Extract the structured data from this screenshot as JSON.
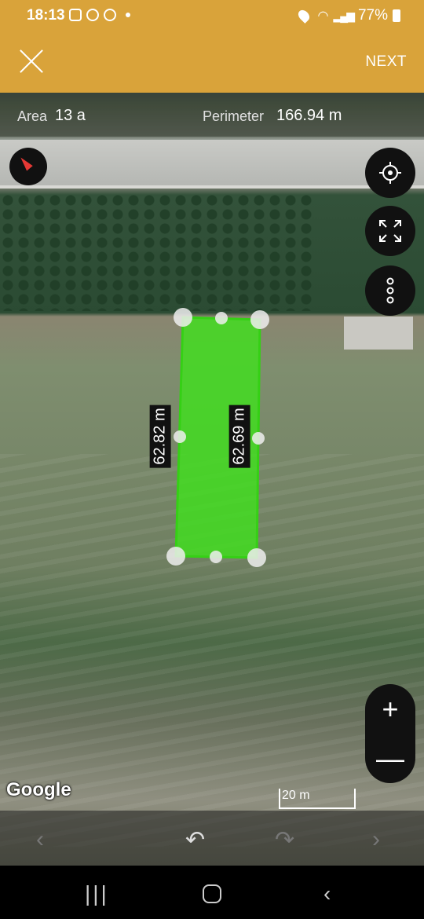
{
  "status_bar": {
    "time": "18:13",
    "battery": "77%"
  },
  "toolbar": {
    "next_label": "NEXT"
  },
  "measurements": {
    "area_label": "Area",
    "area_value": "13 a",
    "perimeter_label": "Perimeter",
    "perimeter_value": "166.94 m"
  },
  "plot": {
    "left_side_label": "62.82 m",
    "right_side_label": "62.69 m",
    "fill_color": "#39e61a"
  },
  "map": {
    "attribution": "Google",
    "scale_label": "20 m"
  },
  "icons": {
    "close": "close-icon",
    "compass": "compass-icon",
    "locate": "my-location-icon",
    "fullscreen": "fullscreen-icon",
    "more": "more-vertical-icon",
    "zoom_in": "plus-icon",
    "zoom_out": "minus-icon",
    "undo": "undo-icon",
    "redo": "redo-icon"
  },
  "zoom": {
    "in_label": "+",
    "out_label": "—"
  }
}
